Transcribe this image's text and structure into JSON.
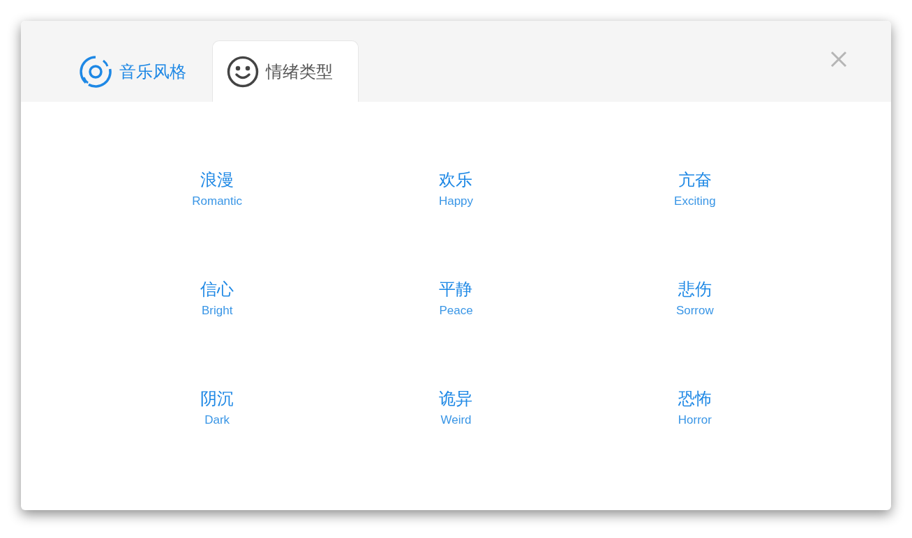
{
  "tabs": [
    {
      "label": "音乐风格",
      "kind": "disc",
      "selected": false
    },
    {
      "label": "情绪类型",
      "kind": "smile",
      "selected": true
    }
  ],
  "moods": [
    {
      "name": "浪漫",
      "english": "Romantic"
    },
    {
      "name": "欢乐",
      "english": "Happy"
    },
    {
      "name": "亢奋",
      "english": "Exciting"
    },
    {
      "name": "信心",
      "english": "Bright"
    },
    {
      "name": "平静",
      "english": "Peace"
    },
    {
      "name": "悲伤",
      "english": "Sorrow"
    },
    {
      "name": "阴沉",
      "english": "Dark"
    },
    {
      "name": "诡异",
      "english": "Weird"
    },
    {
      "name": "恐怖",
      "english": "Horror"
    }
  ]
}
